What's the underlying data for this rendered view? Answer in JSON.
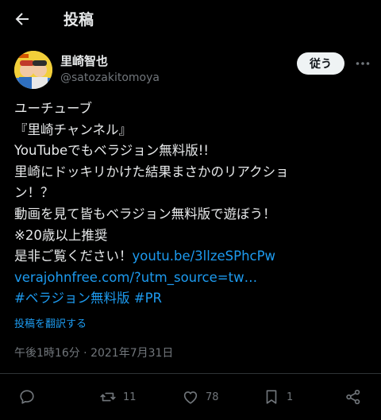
{
  "header": {
    "title": "投稿"
  },
  "author": {
    "name": "里崎智也",
    "handle": "@satozakitomoya"
  },
  "follow_label": "従う",
  "post": {
    "lines": [
      "ユーチューブ",
      "『里崎チャンネル』",
      "YouTubeでもベラジョン無料版!!",
      "里崎にドッキリかけた結果まさかのリアクショ",
      "ン！？",
      "動画を見て皆もベラジョン無料版で遊ぼう！",
      "※20歳以上推奨"
    ],
    "last_prefix": "是非ご覧ください！",
    "link1": "youtu.be/3llzeSPhcPw",
    "link2": "verajohnfree.com/?utm_source=tw…",
    "hashtag1": "#ベラジョン無料版",
    "hashtag2": "#PR"
  },
  "translate_label": "投稿を翻訳する",
  "timestamp": "午後1時16分 · 2021年7月31日",
  "stats": {
    "retweets": "11",
    "likes": "78",
    "bookmarks": "1"
  },
  "colors": {
    "background": "#000000",
    "link": "#1d9bf0",
    "muted": "#71767b",
    "text": "#e7e9ea"
  }
}
